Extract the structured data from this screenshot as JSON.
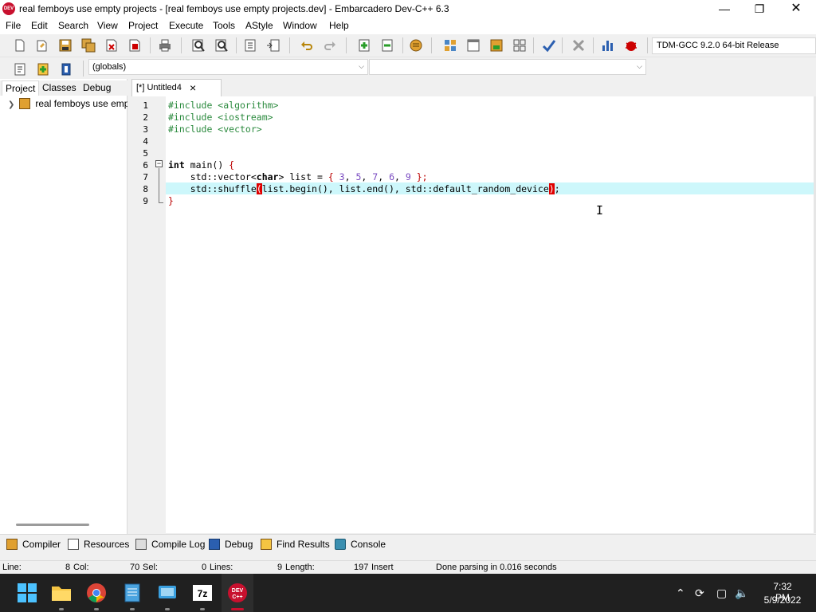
{
  "window": {
    "title": "real femboys use empty projects - [real femboys use empty projects.dev] - Embarcadero Dev-C++ 6.3",
    "app_icon_text": "DEV"
  },
  "menu": [
    "File",
    "Edit",
    "Search",
    "View",
    "Project",
    "Execute",
    "Tools",
    "AStyle",
    "Window",
    "Help"
  ],
  "toolbar": {
    "compiler": "TDM-GCC 9.2.0 64-bit Release",
    "scope_combo": "(globals)",
    "member_combo": ""
  },
  "left_panel": {
    "tabs": [
      "Project",
      "Classes",
      "Debug"
    ],
    "active_tab": "Project",
    "tree_item": "real femboys use empty projects"
  },
  "editor": {
    "tab_label": "[*] Untitled4",
    "line_numbers": [
      "1",
      "2",
      "3",
      "4",
      "5",
      "6",
      "7",
      "8",
      "9"
    ]
  },
  "bottom_tabs": [
    "Compiler",
    "Resources",
    "Compile Log",
    "Debug",
    "Find Results",
    "Console"
  ],
  "status": {
    "line_label": "Line:",
    "line_value": "8",
    "col_label": "Col:",
    "col_value": "70",
    "sel_label": "Sel:",
    "sel_value": "0",
    "lines_label": "Lines:",
    "lines_value": "9",
    "length_label": "Length:",
    "length_value": "197",
    "mode": "Insert",
    "message": "Done parsing in 0.016 seconds"
  },
  "taskbar": {
    "time": "7:32 PM",
    "date": "5/9/2022",
    "apps": [
      "windows-start",
      "file-explorer",
      "chrome",
      "notepad",
      "remote-desktop",
      "7zip",
      "dev-cpp"
    ]
  },
  "colors": {
    "line_highlight": "#cdf7fb",
    "brace_highlight": "#e00000",
    "preprocessor": "#2b8a3e",
    "number": "#7a4bc2"
  }
}
